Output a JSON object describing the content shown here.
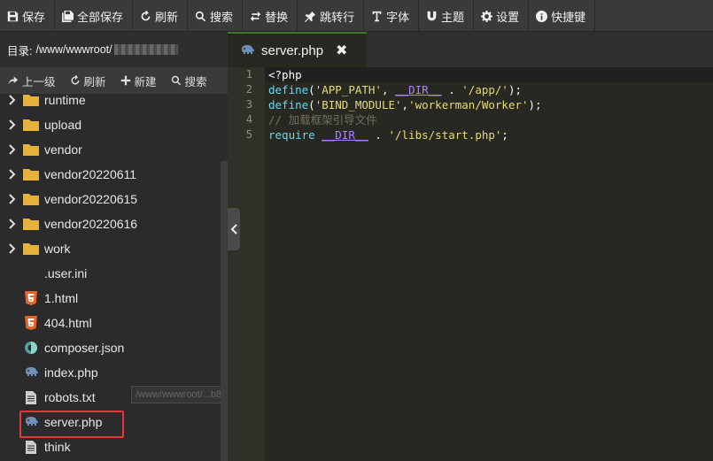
{
  "toolbar": {
    "items": [
      {
        "label": "保存",
        "icon": "save-icon"
      },
      {
        "label": "全部保存",
        "icon": "save-all-icon"
      },
      {
        "label": "刷新",
        "icon": "refresh-icon"
      },
      {
        "label": "搜索",
        "icon": "search-icon"
      },
      {
        "label": "替换",
        "icon": "replace-icon"
      },
      {
        "label": "跳转行",
        "icon": "goto-line-icon"
      },
      {
        "label": "字体",
        "icon": "font-icon"
      },
      {
        "label": "主题",
        "icon": "theme-icon"
      },
      {
        "label": "设置",
        "icon": "gear-icon"
      },
      {
        "label": "快捷键",
        "icon": "info-icon"
      }
    ]
  },
  "sidebar": {
    "directory_label": "目录:",
    "directory_path": "/www/wwwroot/",
    "actions": [
      {
        "label": "上一级",
        "icon": "share-icon"
      },
      {
        "label": "刷新",
        "icon": "refresh-icon"
      },
      {
        "label": "新建",
        "icon": "plus-icon"
      },
      {
        "label": "搜索",
        "icon": "search-icon"
      }
    ],
    "tree": [
      {
        "name": "runtime",
        "type": "folder"
      },
      {
        "name": "upload",
        "type": "folder"
      },
      {
        "name": "vendor",
        "type": "folder"
      },
      {
        "name": "vendor20220611",
        "type": "folder"
      },
      {
        "name": "vendor20220615",
        "type": "folder"
      },
      {
        "name": "vendor20220616",
        "type": "folder"
      },
      {
        "name": "work",
        "type": "folder"
      },
      {
        "name": ".user.ini",
        "type": "file",
        "icon": "none"
      },
      {
        "name": "1.html",
        "type": "file",
        "icon": "html5-icon"
      },
      {
        "name": "404.html",
        "type": "file",
        "icon": "html5-icon"
      },
      {
        "name": "composer.json",
        "type": "file",
        "icon": "json-icon"
      },
      {
        "name": "index.php",
        "type": "file",
        "icon": "php-elephant-icon"
      },
      {
        "name": "robots.txt",
        "type": "file",
        "icon": "text-file-icon"
      },
      {
        "name": "server.php",
        "type": "file",
        "icon": "php-elephant-icon",
        "selected": true
      },
      {
        "name": "think",
        "type": "file",
        "icon": "text-file-icon"
      }
    ],
    "tooltip": "/www/wwwroot/...b8779.cn/.user.ini"
  },
  "editor": {
    "tab_title": "server.php",
    "tab_close": "✖",
    "line_numbers": [
      "1",
      "2",
      "3",
      "4",
      "5"
    ],
    "lines": [
      "<?php",
      "define('APP_PATH', __DIR__ . '/app/');",
      "define('BIND_MODULE','workerman/Worker');",
      "// 加载框架引导文件",
      "require __DIR__ . '/libs/start.php';"
    ]
  },
  "colors": {
    "toolbar_bg": "#3a3a3a",
    "editor_bg": "#272822",
    "tab_accent": "#3b7a2b",
    "selection_outline": "#e0393e"
  }
}
